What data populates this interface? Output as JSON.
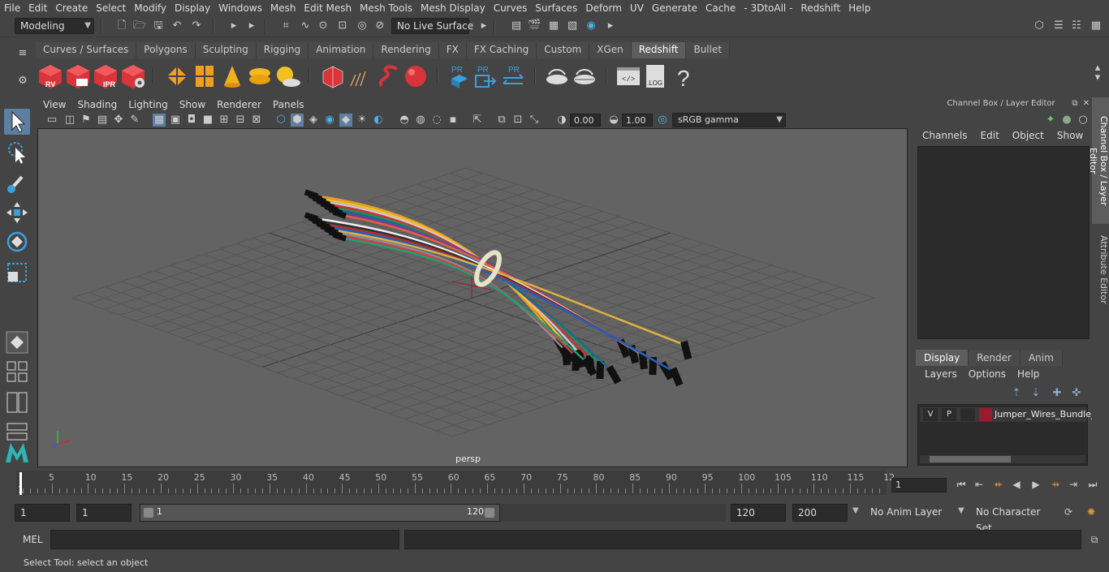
{
  "menubar": {
    "items": [
      "File",
      "Edit",
      "Create",
      "Select",
      "Modify",
      "Display",
      "Windows",
      "Mesh",
      "Edit Mesh",
      "Mesh Tools",
      "Mesh Display",
      "Curves",
      "Surfaces",
      "Deform",
      "UV",
      "Generate",
      "Cache",
      "- 3DtoAll -",
      "Redshift",
      "Help"
    ]
  },
  "toolbar": {
    "mode": "Modeling",
    "live_surface": "No Live Surface"
  },
  "shelf": {
    "tabs": [
      "Curves / Surfaces",
      "Polygons",
      "Sculpting",
      "Rigging",
      "Animation",
      "Rendering",
      "FX",
      "FX Caching",
      "Custom",
      "XGen",
      "Redshift",
      "Bullet"
    ],
    "active_tab": "Redshift",
    "icon_labels": {
      "rv": "RV",
      "ipr": "IPR",
      "pr1": "PR",
      "pr2": "PR",
      "pr3": "PR",
      "log": ".LOG",
      "help": "?"
    }
  },
  "viewport": {
    "menu": [
      "View",
      "Shading",
      "Lighting",
      "Show",
      "Renderer",
      "Panels"
    ],
    "exposure": "0.00",
    "gamma": "1.00",
    "color_space": "sRGB gamma",
    "camera_label": "persp"
  },
  "right_panel": {
    "title": "Channel Box / Layer Editor",
    "channel_menu": [
      "Channels",
      "Edit",
      "Object",
      "Show"
    ],
    "layer_tabs": [
      "Display",
      "Render",
      "Anim"
    ],
    "active_layer_tab": "Display",
    "layer_menu": [
      "Layers",
      "Options",
      "Help"
    ],
    "layer": {
      "v": "V",
      "p": "P",
      "name": "Jumper_Wires_Bundle_",
      "color": "#9b1a2c"
    },
    "side_tabs": [
      "Channel Box / Layer Editor",
      "Attribute Editor"
    ]
  },
  "timeline": {
    "tick_labels": [
      "5",
      "10",
      "15",
      "20",
      "25",
      "30",
      "35",
      "40",
      "45",
      "50",
      "55",
      "60",
      "65",
      "70",
      "75",
      "80",
      "85",
      "90",
      "95",
      "100",
      "105",
      "110",
      "115",
      "12"
    ],
    "start_label": "1",
    "current_frame": "1"
  },
  "range": {
    "start": "1",
    "playback_start": "1",
    "slider_start": "1",
    "slider_end": "120",
    "playback_end": "120",
    "end": "200",
    "anim_layer": "No Anim Layer",
    "character_set": "No Character Set"
  },
  "command": {
    "label": "MEL"
  },
  "status": {
    "text": "Select Tool: select an object"
  },
  "colors": {
    "accent": "#5d7fa3",
    "redshift_red": "#e0393e",
    "redshift_blue": "#3aa0dc"
  }
}
